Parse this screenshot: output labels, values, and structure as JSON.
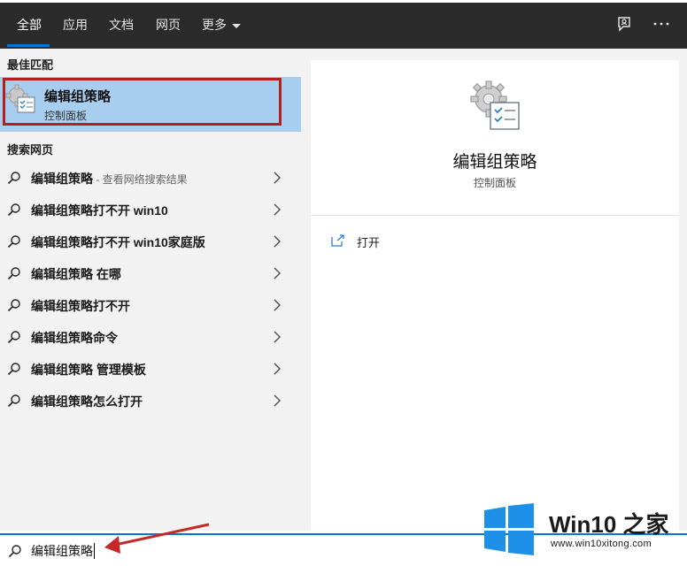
{
  "tabs": [
    {
      "label": "全部",
      "active": true
    },
    {
      "label": "应用"
    },
    {
      "label": "文档"
    },
    {
      "label": "网页"
    },
    {
      "label": "更多"
    }
  ],
  "top_icons": [
    "feedback-icon",
    "more-options-icon"
  ],
  "best_match": {
    "heading": "最佳匹配",
    "title": "编辑组策略",
    "subtitle": "控制面板",
    "icon": "group-policy-icon"
  },
  "web": {
    "heading": "搜索网页",
    "items": [
      {
        "text": "编辑组策略",
        "hint": " - 查看网络搜索结果"
      },
      {
        "text": "编辑组策略打不开 win10"
      },
      {
        "text": "编辑组策略打不开 win10家庭版"
      },
      {
        "text": "编辑组策略 在哪"
      },
      {
        "text": "编辑组策略打不开"
      },
      {
        "text": "编辑组策略命令"
      },
      {
        "text": "编辑组策略 管理模板"
      },
      {
        "text": "编辑组策略怎么打开"
      }
    ]
  },
  "detail": {
    "title": "编辑组策略",
    "subtitle": "控制面板",
    "open_label": "打开"
  },
  "search": {
    "value": "编辑组策略"
  },
  "watermark": {
    "title": "Win10 之家",
    "url": "www.win10xitong.com"
  },
  "colors": {
    "accent": "#0078d7",
    "highlight": "#a7cdef",
    "annotation_red": "#b31f1f"
  }
}
